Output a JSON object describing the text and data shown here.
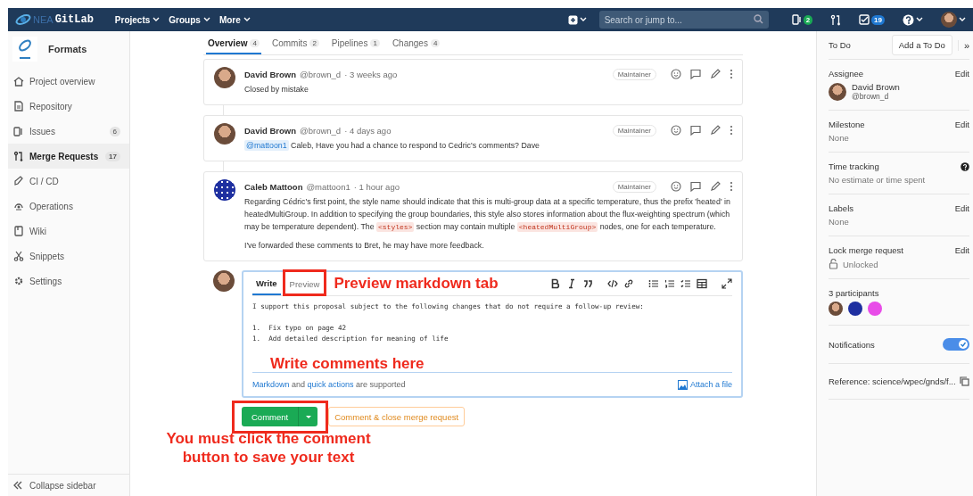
{
  "navbar": {
    "logo_prefix": "NEA",
    "logo_name": "GitLab",
    "menus": [
      "Projects",
      "Groups",
      "More"
    ],
    "search": {
      "placeholder": "Search or jump to..."
    },
    "issues_count": "2",
    "todos_count": "19"
  },
  "sidebar": {
    "project": "Formats",
    "items": [
      {
        "label": "Project overview",
        "selected": false
      },
      {
        "label": "Repository",
        "selected": false
      },
      {
        "label": "Issues",
        "count": "6",
        "selected": false
      },
      {
        "label": "Merge Requests",
        "count": "17",
        "selected": true
      },
      {
        "label": "CI / CD",
        "selected": false
      },
      {
        "label": "Operations",
        "selected": false
      },
      {
        "label": "Wiki",
        "selected": false
      },
      {
        "label": "Snippets",
        "selected": false
      },
      {
        "label": "Settings",
        "selected": false
      }
    ],
    "collapse": "Collapse sidebar"
  },
  "tabs": [
    {
      "label": "Overview",
      "count": "4",
      "selected": true
    },
    {
      "label": "Commits",
      "count": "2",
      "selected": false
    },
    {
      "label": "Pipelines",
      "count": "1",
      "selected": false
    },
    {
      "label": "Changes",
      "count": "4",
      "selected": false
    }
  ],
  "notes": [
    {
      "author": "David Brown",
      "username": "@brown_d",
      "time": "· 3 weeks ago",
      "role": "Maintainer",
      "avatar": {
        "kind": "photo"
      },
      "paragraphs": [
        [
          {
            "kind": "text",
            "text": "Closed by mistake"
          }
        ]
      ]
    },
    {
      "author": "David Brown",
      "username": "@brown_d",
      "time": "· 4 days ago",
      "role": "Maintainer",
      "avatar": {
        "kind": "photo"
      },
      "paragraphs": [
        [
          {
            "kind": "mention",
            "text": "@mattoon1"
          },
          {
            "kind": "text",
            "text": " Caleb, Have you had a chance to respond to Cedric's comments? Dave"
          }
        ]
      ]
    },
    {
      "author": "Caleb Mattoon",
      "username": "@mattoon1",
      "time": "· 1 hour ago",
      "role": "Maintainer",
      "avatar": {
        "kind": "identicon"
      },
      "paragraphs": [
        [
          {
            "kind": "text",
            "text": "Regarding Cédric's first point, the style name should indicate that this is multi-group data at a specific temperature, thus the prefix 'heated' in heatedMultiGroup. In addition to specifying the group boundaries, this style also stores information about the flux-weighting spectrum (which may be temperature dependent). The "
          },
          {
            "kind": "code",
            "text": "<styles>"
          },
          {
            "kind": "text",
            "text": " section may contain multiple "
          },
          {
            "kind": "code",
            "text": "<heatedMultiGroup>"
          },
          {
            "kind": "text",
            "text": " nodes, one for each temperature."
          }
        ],
        [
          {
            "kind": "text",
            "text": "I've forwarded these comments to Bret, he may have more feedback."
          }
        ]
      ]
    }
  ],
  "comment_form": {
    "tabs": [
      {
        "label": "Write",
        "selected": true,
        "annotated": false
      },
      {
        "label": "Preview",
        "selected": false,
        "annotated": true
      }
    ],
    "value": "I support this proposal subject to the following changes that do not require a follow-up review:\n\n1.  Fix typo on page 42\n1.  Add detailed description for meaning of life",
    "footer": [
      {
        "kind": "link",
        "text": "Markdown"
      },
      {
        "kind": "text",
        "text": " and "
      },
      {
        "kind": "link",
        "text": "quick actions"
      },
      {
        "kind": "text",
        "text": " are supported"
      }
    ],
    "attach": "Attach a file",
    "submit": {
      "label": "Comment",
      "annotated": true
    },
    "close": "Comment & close merge request"
  },
  "annotations": {
    "preview_tab": "Preview markdown tab",
    "editor": "Write comments here",
    "submit": "You must click the comment button to save your text"
  },
  "right_sidebar": {
    "todo_label": "To Do",
    "todo_button": "Add a To Do",
    "collapse_label": "»",
    "sections": [
      {
        "kind": "assignee",
        "title": "Assignee",
        "action": "Edit",
        "name": "David Brown",
        "username": "@brown_d"
      },
      {
        "kind": "field",
        "title": "Milestone",
        "action": "Edit",
        "value": "None"
      },
      {
        "kind": "help",
        "title": "Time tracking",
        "value": "No estimate or time spent"
      },
      {
        "kind": "field",
        "title": "Labels",
        "action": "Edit",
        "value": "None"
      },
      {
        "kind": "lock",
        "title": "Lock merge request",
        "action": "Edit",
        "value": "Unlocked"
      },
      {
        "kind": "participants",
        "title": "3 participants"
      },
      {
        "kind": "toggle",
        "title": "Notifications",
        "on": true
      },
      {
        "kind": "reference",
        "title": "Reference: science/wpec/gnds/f..."
      }
    ]
  }
}
